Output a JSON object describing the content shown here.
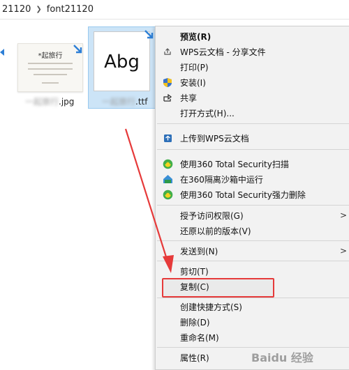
{
  "breadcrumb": {
    "parent": "21120",
    "current": "font21120"
  },
  "files": {
    "jpg": {
      "thumb_title": "*起旅行",
      "label_visible": ".jpg"
    },
    "ttf": {
      "preview_text": "Abg",
      "label_visible": ".ttf"
    }
  },
  "menu": {
    "items": [
      {
        "label": "预览(R)",
        "icon": "none"
      },
      {
        "label": "WPS云文档 - 分享文件",
        "icon": "share-icon"
      },
      {
        "label": "打印(P)",
        "icon": "none"
      },
      {
        "label": "安装(I)",
        "icon": "shield-icon"
      },
      {
        "label": "共享",
        "icon": "share-arrow-icon"
      },
      {
        "label": "打开方式(H)...",
        "icon": "none"
      },
      {
        "label": "上传到WPS云文档",
        "icon": "cloud-upload-icon"
      },
      {
        "label": "使用360 Total Security扫描",
        "icon": "360-icon"
      },
      {
        "label": "在360隔离沙箱中运行",
        "icon": "sandbox-icon"
      },
      {
        "label": "使用360 Total Security强力删除",
        "icon": "360-icon"
      },
      {
        "label": "授予访问权限(G)",
        "icon": "none"
      },
      {
        "label": "还原以前的版本(V)",
        "icon": "none"
      },
      {
        "label": "发送到(N)",
        "icon": "none"
      },
      {
        "label": "剪切(T)",
        "icon": "none"
      },
      {
        "label": "复制(C)",
        "icon": "none"
      },
      {
        "label": "创建快捷方式(S)",
        "icon": "none"
      },
      {
        "label": "删除(D)",
        "icon": "none"
      },
      {
        "label": "重命名(M)",
        "icon": "none"
      },
      {
        "label": "属性(R)",
        "icon": "none"
      }
    ],
    "submenu_glyph": ">"
  },
  "watermark": "Baidu 经验",
  "colors": {
    "selection": "#cce4f7",
    "highlight_box": "#e63a3a",
    "annotation_arrow": "#e63a3a",
    "menu_bg": "#f2f2f2"
  }
}
